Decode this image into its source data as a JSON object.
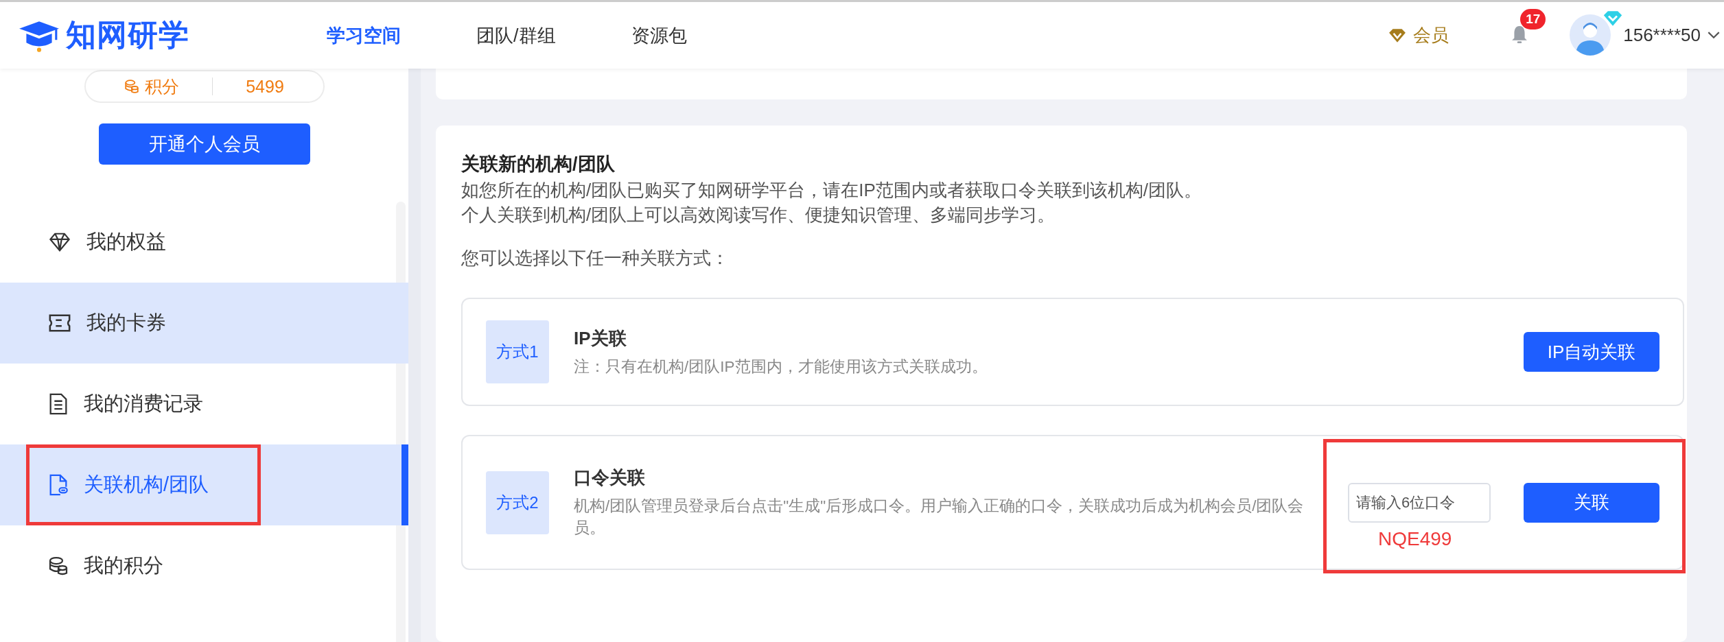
{
  "header": {
    "logo_text": "知网研学",
    "nav": [
      {
        "label": "学习空间",
        "selected": true
      },
      {
        "label": "团队/群组",
        "selected": false
      },
      {
        "label": "资源包",
        "selected": false
      }
    ],
    "member_label": "会员",
    "notification_count": "17",
    "username": "156****50"
  },
  "sidebar": {
    "points_label": "积分",
    "points_value": "5499",
    "vip_button": "开通个人会员",
    "items": [
      {
        "label": "我的权益",
        "kind": "diamond",
        "selected": false,
        "hovered": false
      },
      {
        "label": "我的卡券",
        "kind": "ticket",
        "selected": false,
        "hovered": true
      },
      {
        "label": "我的消费记录",
        "kind": "document",
        "selected": false,
        "hovered": false
      },
      {
        "label": "关联机构/团队",
        "kind": "link-document",
        "selected": true,
        "hovered": false,
        "annotated": true
      },
      {
        "label": "我的积分",
        "kind": "coins",
        "selected": false,
        "hovered": false
      }
    ]
  },
  "main": {
    "title": "关联新的机构/团队",
    "intro": [
      "如您所在的机构/团队已购买了知网研学平台，请在IP范围内或者获取口令关联到该机构/团队。",
      "个人关联到机构/团队上可以高效阅读写作、便捷知识管理、多端同步学习。"
    ],
    "choose_text": "您可以选择以下任一种关联方式：",
    "methods": [
      {
        "kind": "ip",
        "badge": "方式1",
        "title": "IP关联",
        "description_lines": [
          "注：只有在机构/团队IP范围内，才能使用该方式关联成功。"
        ],
        "button": "IP自动关联",
        "annotated": false
      },
      {
        "kind": "code",
        "badge": "方式2",
        "title": "口令关联",
        "description_lines": [
          "机构/团队管理员登录后台点击\"生成\"后形成口令。用户输入正确的口令，关联成功后成为机构会员/团队会",
          "员。"
        ],
        "placeholder": "请输入6位口令",
        "annotation": "NQE499",
        "button": "关联",
        "annotated": true
      }
    ]
  }
}
